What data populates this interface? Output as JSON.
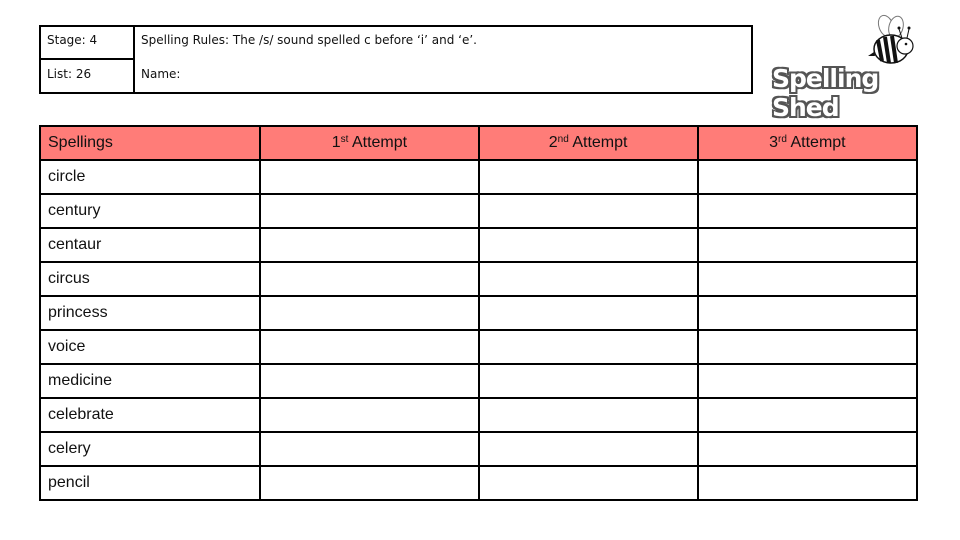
{
  "info": {
    "stage": "Stage: 4",
    "list": "List: 26",
    "rules": "Spelling Rules:  The /s/ sound spelled c before ‘i’ and ‘e’.",
    "name_label": "Name:"
  },
  "logo": {
    "text": "Spelling Shed",
    "icon": "bee-icon"
  },
  "table": {
    "header_color": "#FF7C78",
    "headers": [
      {
        "label": "Spellings",
        "sup": "",
        "suffix": ""
      },
      {
        "label": "1",
        "sup": "st",
        "suffix": " Attempt"
      },
      {
        "label": "2",
        "sup": "nd",
        "suffix": " Attempt"
      },
      {
        "label": "3",
        "sup": "rd",
        "suffix": " Attempt"
      }
    ],
    "words": [
      "circle",
      "century",
      "centaur",
      "circus",
      "princess",
      "voice",
      "medicine",
      "celebrate",
      "celery",
      "pencil"
    ]
  }
}
